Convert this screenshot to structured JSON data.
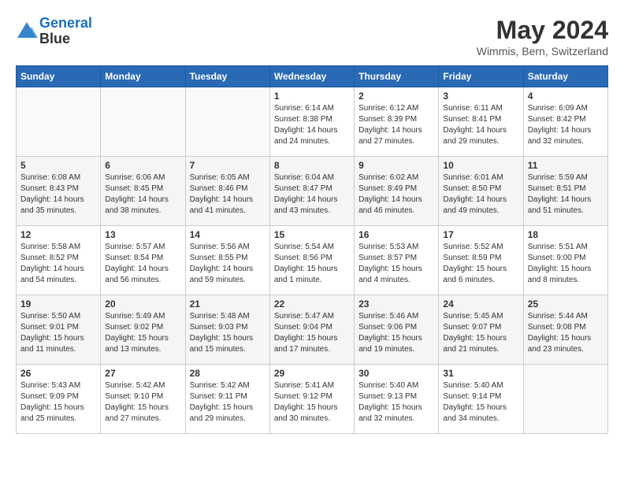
{
  "header": {
    "logo_line1": "General",
    "logo_line2": "Blue",
    "month_year": "May 2024",
    "location": "Wimmis, Bern, Switzerland"
  },
  "days_of_week": [
    "Sunday",
    "Monday",
    "Tuesday",
    "Wednesday",
    "Thursday",
    "Friday",
    "Saturday"
  ],
  "weeks": [
    [
      {
        "day": "",
        "text": ""
      },
      {
        "day": "",
        "text": ""
      },
      {
        "day": "",
        "text": ""
      },
      {
        "day": "1",
        "text": "Sunrise: 6:14 AM\nSunset: 8:38 PM\nDaylight: 14 hours\nand 24 minutes."
      },
      {
        "day": "2",
        "text": "Sunrise: 6:12 AM\nSunset: 8:39 PM\nDaylight: 14 hours\nand 27 minutes."
      },
      {
        "day": "3",
        "text": "Sunrise: 6:11 AM\nSunset: 8:41 PM\nDaylight: 14 hours\nand 29 minutes."
      },
      {
        "day": "4",
        "text": "Sunrise: 6:09 AM\nSunset: 8:42 PM\nDaylight: 14 hours\nand 32 minutes."
      }
    ],
    [
      {
        "day": "5",
        "text": "Sunrise: 6:08 AM\nSunset: 8:43 PM\nDaylight: 14 hours\nand 35 minutes."
      },
      {
        "day": "6",
        "text": "Sunrise: 6:06 AM\nSunset: 8:45 PM\nDaylight: 14 hours\nand 38 minutes."
      },
      {
        "day": "7",
        "text": "Sunrise: 6:05 AM\nSunset: 8:46 PM\nDaylight: 14 hours\nand 41 minutes."
      },
      {
        "day": "8",
        "text": "Sunrise: 6:04 AM\nSunset: 8:47 PM\nDaylight: 14 hours\nand 43 minutes."
      },
      {
        "day": "9",
        "text": "Sunrise: 6:02 AM\nSunset: 8:49 PM\nDaylight: 14 hours\nand 46 minutes."
      },
      {
        "day": "10",
        "text": "Sunrise: 6:01 AM\nSunset: 8:50 PM\nDaylight: 14 hours\nand 49 minutes."
      },
      {
        "day": "11",
        "text": "Sunrise: 5:59 AM\nSunset: 8:51 PM\nDaylight: 14 hours\nand 51 minutes."
      }
    ],
    [
      {
        "day": "12",
        "text": "Sunrise: 5:58 AM\nSunset: 8:52 PM\nDaylight: 14 hours\nand 54 minutes."
      },
      {
        "day": "13",
        "text": "Sunrise: 5:57 AM\nSunset: 8:54 PM\nDaylight: 14 hours\nand 56 minutes."
      },
      {
        "day": "14",
        "text": "Sunrise: 5:56 AM\nSunset: 8:55 PM\nDaylight: 14 hours\nand 59 minutes."
      },
      {
        "day": "15",
        "text": "Sunrise: 5:54 AM\nSunset: 8:56 PM\nDaylight: 15 hours\nand 1 minute."
      },
      {
        "day": "16",
        "text": "Sunrise: 5:53 AM\nSunset: 8:57 PM\nDaylight: 15 hours\nand 4 minutes."
      },
      {
        "day": "17",
        "text": "Sunrise: 5:52 AM\nSunset: 8:59 PM\nDaylight: 15 hours\nand 6 minutes."
      },
      {
        "day": "18",
        "text": "Sunrise: 5:51 AM\nSunset: 9:00 PM\nDaylight: 15 hours\nand 8 minutes."
      }
    ],
    [
      {
        "day": "19",
        "text": "Sunrise: 5:50 AM\nSunset: 9:01 PM\nDaylight: 15 hours\nand 11 minutes."
      },
      {
        "day": "20",
        "text": "Sunrise: 5:49 AM\nSunset: 9:02 PM\nDaylight: 15 hours\nand 13 minutes."
      },
      {
        "day": "21",
        "text": "Sunrise: 5:48 AM\nSunset: 9:03 PM\nDaylight: 15 hours\nand 15 minutes."
      },
      {
        "day": "22",
        "text": "Sunrise: 5:47 AM\nSunset: 9:04 PM\nDaylight: 15 hours\nand 17 minutes."
      },
      {
        "day": "23",
        "text": "Sunrise: 5:46 AM\nSunset: 9:06 PM\nDaylight: 15 hours\nand 19 minutes."
      },
      {
        "day": "24",
        "text": "Sunrise: 5:45 AM\nSunset: 9:07 PM\nDaylight: 15 hours\nand 21 minutes."
      },
      {
        "day": "25",
        "text": "Sunrise: 5:44 AM\nSunset: 9:08 PM\nDaylight: 15 hours\nand 23 minutes."
      }
    ],
    [
      {
        "day": "26",
        "text": "Sunrise: 5:43 AM\nSunset: 9:09 PM\nDaylight: 15 hours\nand 25 minutes."
      },
      {
        "day": "27",
        "text": "Sunrise: 5:42 AM\nSunset: 9:10 PM\nDaylight: 15 hours\nand 27 minutes."
      },
      {
        "day": "28",
        "text": "Sunrise: 5:42 AM\nSunset: 9:11 PM\nDaylight: 15 hours\nand 29 minutes."
      },
      {
        "day": "29",
        "text": "Sunrise: 5:41 AM\nSunset: 9:12 PM\nDaylight: 15 hours\nand 30 minutes."
      },
      {
        "day": "30",
        "text": "Sunrise: 5:40 AM\nSunset: 9:13 PM\nDaylight: 15 hours\nand 32 minutes."
      },
      {
        "day": "31",
        "text": "Sunrise: 5:40 AM\nSunset: 9:14 PM\nDaylight: 15 hours\nand 34 minutes."
      },
      {
        "day": "",
        "text": ""
      }
    ]
  ]
}
